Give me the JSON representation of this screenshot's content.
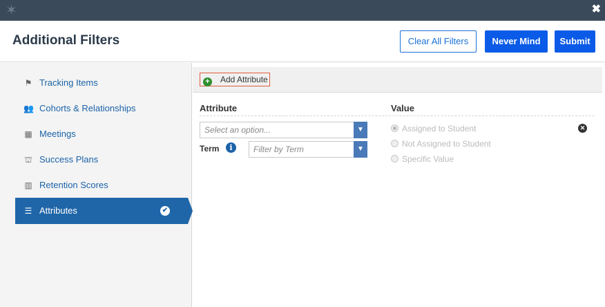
{
  "window": {
    "logo_icon": "star-logo-icon",
    "close_glyph": "✖"
  },
  "header": {
    "title": "Additional Filters",
    "clear_all_label": "Clear All Filters",
    "never_mind_label": "Never Mind",
    "submit_label": "Submit"
  },
  "sidebar": {
    "items": [
      {
        "label": "Tracking Items",
        "icon": "flag-icon",
        "glyph": "⚑"
      },
      {
        "label": "Cohorts & Relationships",
        "icon": "users-icon",
        "glyph": "👥"
      },
      {
        "label": "Meetings",
        "icon": "calendar-icon",
        "glyph": "▦"
      },
      {
        "label": "Success Plans",
        "icon": "sitemap-icon",
        "glyph": "⛫"
      },
      {
        "label": "Retention Scores",
        "icon": "bar-chart-icon",
        "glyph": "▥"
      },
      {
        "label": "Attributes",
        "icon": "sliders-icon",
        "glyph": "☰",
        "active": true
      }
    ]
  },
  "main": {
    "add_attribute_label": "Add Attribute",
    "columns": {
      "attribute": "Attribute",
      "value": "Value"
    },
    "attribute_select": {
      "placeholder": "Select an option..."
    },
    "term": {
      "label": "Term",
      "placeholder": "Filter by Term"
    },
    "value_options": [
      {
        "label": "Assigned to Student",
        "selected": true
      },
      {
        "label": "Not Assigned to Student",
        "selected": false
      },
      {
        "label": "Specific Value",
        "selected": false
      }
    ]
  },
  "colors": {
    "topbar": "#3b4a5a",
    "accent_blue": "#0b5be8",
    "active_nav": "#1f66a8",
    "link_blue": "#1a62a8"
  }
}
